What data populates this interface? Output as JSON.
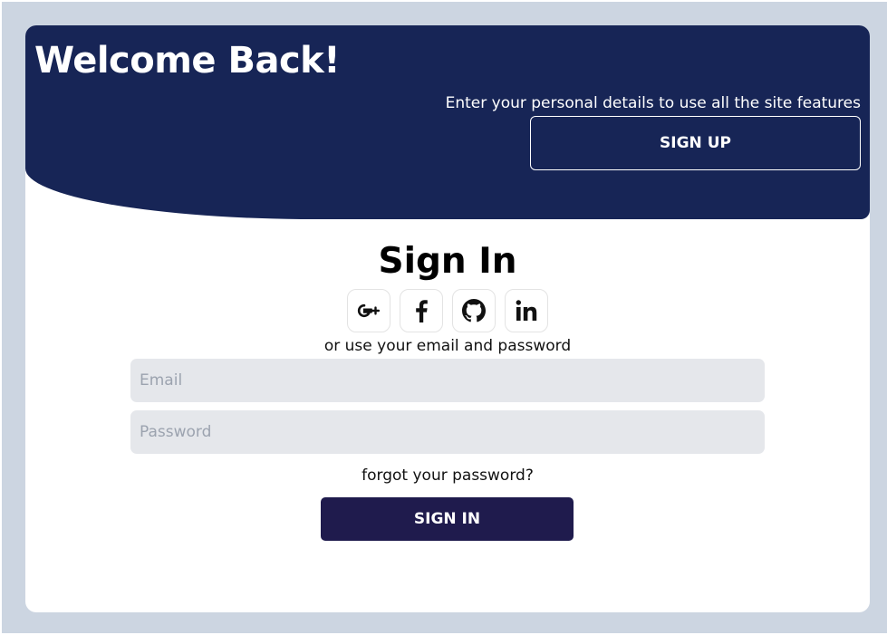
{
  "banner": {
    "heading": "Welcome Back!",
    "subtitle": "Enter your personal details to use all the site features",
    "signup_label": "SIGN UP"
  },
  "form": {
    "title": "Sign In",
    "social_icons": [
      "google-plus-icon",
      "facebook-icon",
      "github-icon",
      "linkedin-icon"
    ],
    "alt_text": "or use your email and password",
    "email_placeholder": "Email",
    "password_placeholder": "Password",
    "forgot_label": "forgot your password?",
    "signin_label": "SIGN IN"
  },
  "colors": {
    "banner": "#172556",
    "signin_button": "#1f1b4d",
    "page_background": "#ccd5e1",
    "input_background": "#e5e7eb"
  }
}
